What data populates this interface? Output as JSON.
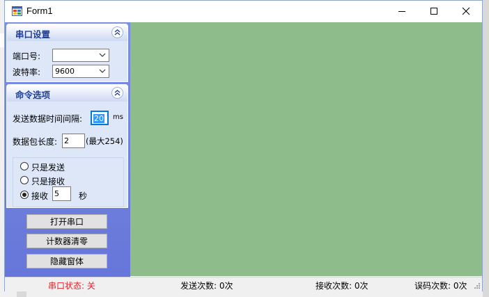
{
  "window": {
    "title": "Form1",
    "minimize_glyph": "—",
    "maximize_glyph": "☐",
    "close_glyph": "✕"
  },
  "serial_group": {
    "title": "串口设置",
    "port_label": "端口号:",
    "port_value": "",
    "baud_label": "波特率:",
    "baud_value": "9600"
  },
  "command_group": {
    "title": "命令选项",
    "interval_label": "发送数据时间间隔:",
    "interval_value": "20",
    "interval_unit": "ms",
    "packet_label": "数据包长度:",
    "packet_value": "2",
    "packet_hint": "(最大254)",
    "radio_send_only": "只是发送",
    "radio_receive_only": "只是接收",
    "radio_receive": "接收",
    "receive_seconds": "5",
    "receive_unit": "秒",
    "selected_radio": "receive"
  },
  "buttons": {
    "open_port": "打开串口",
    "reset_counter": "计数器清零",
    "hide_window": "隐藏窗体"
  },
  "status": {
    "port_status": "串口状态: 关",
    "send_count": "发送次数: 0次",
    "receive_count": "接收次数: 0次",
    "error_count": "误码次数: 0次"
  },
  "colors": {
    "main_area": "#8fbc8b",
    "panel_gradient_top": "#7d8fe0",
    "group_title": "#1d3f9a",
    "port_status_text": "#e0202a"
  }
}
